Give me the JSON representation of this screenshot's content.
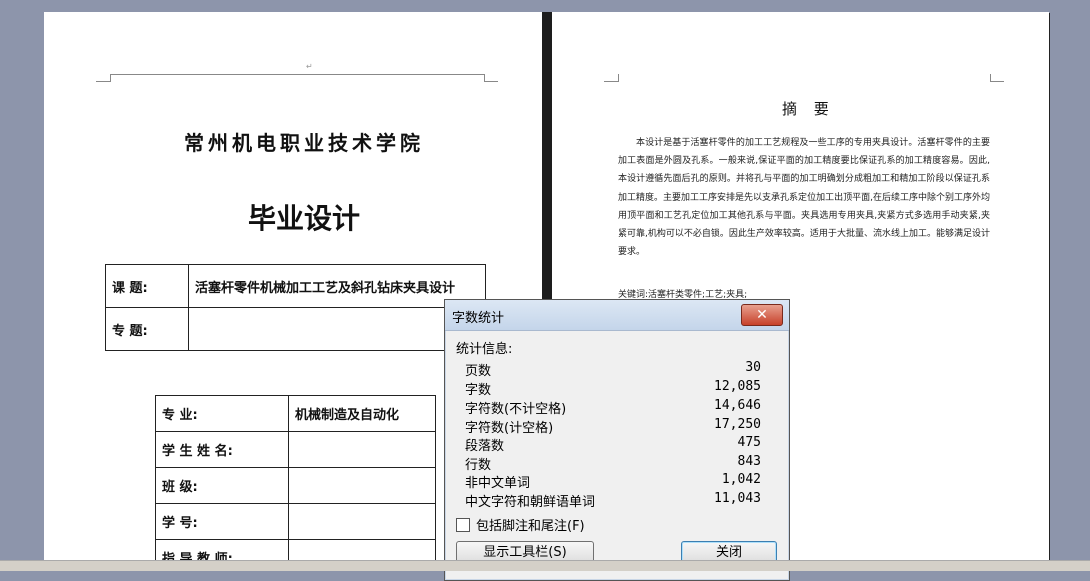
{
  "left_page": {
    "school": "常州机电职业技术学院",
    "title": "毕业设计",
    "topic_label": "课   题:",
    "topic_value": "活塞杆零件机械加工工艺及斜孔钻床夹具设计",
    "subject_label": "专   题:",
    "rows": [
      {
        "label": "专        业:",
        "value": "机械制造及自动化"
      },
      {
        "label": "学 生 姓 名:",
        "value": ""
      },
      {
        "label": "班        级:",
        "value": ""
      },
      {
        "label": "学        号:",
        "value": ""
      },
      {
        "label": "指 导 教 师:",
        "value": ""
      }
    ]
  },
  "right_page": {
    "abstract_title": "摘 要",
    "abstract_body": "本设计是基于活塞杆零件的加工工艺规程及一些工序的专用夹具设计。活塞杆零件的主要加工表面是外圆及孔系。一般来说,保证平面的加工精度要比保证孔系的加工精度容易。因此,本设计遵循先面后孔的原则。并将孔与平面的加工明确划分成粗加工和精加工阶段以保证孔系加工精度。主要加工工序安排是先以支承孔系定位加工出顶平面,在后续工序中除个别工序外均用顶平面和工艺孔定位加工其他孔系与平面。夹具选用专用夹具,夹紧方式多选用手动夹紧,夹紧可靠,机构可以不必自锁。因此生产效率较高。适用于大批量、流水线上加工。能够满足设计要求。",
    "keywords": "关键词:活塞杆类零件;工艺;夹具;"
  },
  "dialog": {
    "title": "字数统计",
    "close_glyph": "✕",
    "stats_heading": "统计信息:",
    "stats": [
      {
        "label": "页数",
        "value": "30"
      },
      {
        "label": "字数",
        "value": "12,085"
      },
      {
        "label": "字符数(不计空格)",
        "value": "14,646"
      },
      {
        "label": "字符数(计空格)",
        "value": "17,250"
      },
      {
        "label": "段落数",
        "value": "475"
      },
      {
        "label": "行数",
        "value": "843"
      },
      {
        "label": "非中文单词",
        "value": "1,042"
      },
      {
        "label": "中文字符和朝鲜语单词",
        "value": "11,043"
      }
    ],
    "checkbox_label": "包括脚注和尾注(F)",
    "checkbox_checked": false,
    "show_toolbar_label": "显示工具栏(S)",
    "close_label": "关闭"
  }
}
